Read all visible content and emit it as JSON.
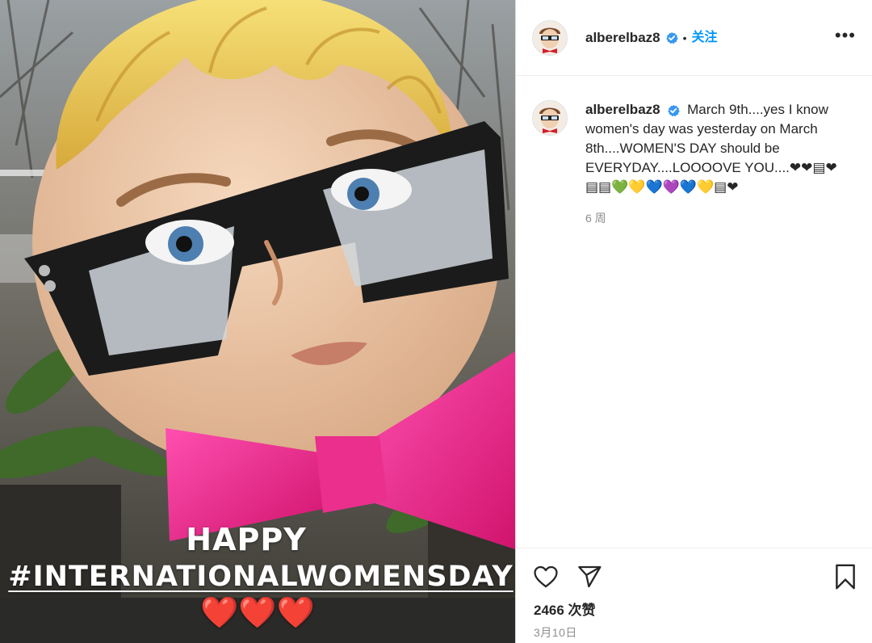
{
  "post": {
    "username": "alberelbaz8",
    "follow_label": "关注",
    "dot": "•",
    "more": "•••",
    "caption_text": "March 9th....yes I know women's day was yesterday on March 8th....WOMEN'S DAY should be EVERYDAY....LOOOOVE YOU....❤❤▤❤▤▤💚💛💙💜💙💛▤❤",
    "time_ago": "6 周",
    "likes": "2466 次赞",
    "date": "3月10日"
  },
  "media": {
    "overlay_line1": "HAPPY",
    "overlay_line2": "#INTERNATIONALWOMENSDAY",
    "overlay_hearts": "❤️❤️❤️"
  },
  "icons": [
    "verified-badge-icon",
    "more-icon",
    "heart-icon",
    "share-icon",
    "bookmark-icon"
  ],
  "colors": {
    "accent": "#0095f6",
    "text": "#262626",
    "muted": "#8e8e8e",
    "bowtie": "#e6257f"
  }
}
